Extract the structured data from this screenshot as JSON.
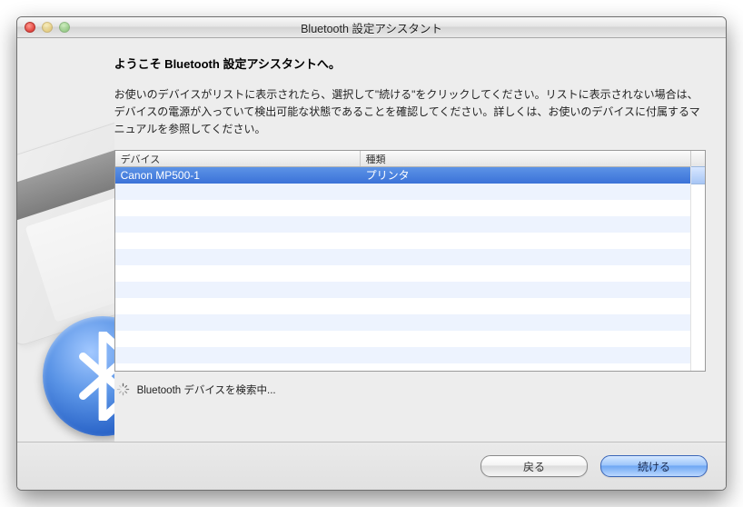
{
  "window": {
    "title": "Bluetooth 設定アシスタント"
  },
  "heading": "ようこそ Bluetooth 設定アシスタントへ。",
  "instructions": "お使いのデバイスがリストに表示されたら、選択して\"続ける\"をクリックしてください。リストに表示されない場合は、デバイスの電源が入っていて検出可能な状態であることを確認してください。詳しくは、お使いのデバイスに付属するマニュアルを参照してください。",
  "columns": {
    "device": "デバイス",
    "type": "種類"
  },
  "devices": [
    {
      "name": "Canon MP500-1",
      "type": "プリンタ",
      "selected": true
    }
  ],
  "status": {
    "text": "Bluetooth デバイスを検索中..."
  },
  "buttons": {
    "back": "戻る",
    "continue": "続ける"
  },
  "sidebar_icon": "bluetooth-icon"
}
